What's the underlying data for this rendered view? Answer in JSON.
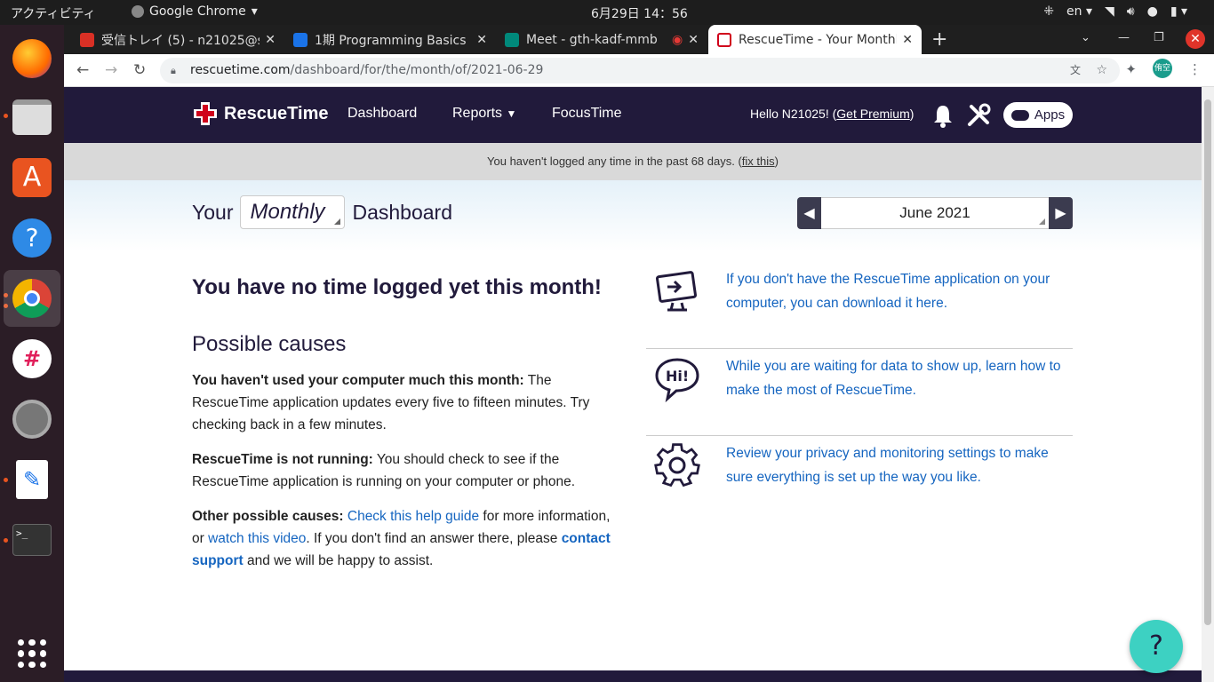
{
  "system": {
    "activities": "アクティビティ",
    "app_menu": "Google Chrome",
    "clock": "6月29日 14：56",
    "keyboard_layout": "en"
  },
  "dock": {
    "items": [
      "firefox",
      "files",
      "ubuntu-software",
      "help",
      "chrome",
      "slack",
      "settings",
      "text-editor",
      "terminal",
      "show-applications"
    ]
  },
  "browser": {
    "tabs": [
      {
        "label": "受信トレイ (5) - n21025@s",
        "favicon_color": "#d93025"
      },
      {
        "label": "1期 Programming Basics",
        "favicon_color": "#1a73e8"
      },
      {
        "label": "Meet - gth-kadf-mmb",
        "favicon_color": "#00897b"
      },
      {
        "label": "RescueTime - Your Monthl",
        "favicon_color": "#d0021b",
        "active": true
      }
    ],
    "url_domain": "rescuetime.com",
    "url_path": "/dashboard/for/the/month/of/2021-06-29",
    "profile_initials": "侑空"
  },
  "header": {
    "logo_text": "RescueTime",
    "nav": [
      "Dashboard",
      "Reports",
      "FocusTime"
    ],
    "greeting": "Hello N21025! (",
    "get_premium": "Get Premium",
    "greeting_end": ")",
    "apps_label": "Apps"
  },
  "warning": {
    "text": "You haven't logged any time in the past 68 days. (",
    "fix_link": "fix this",
    "text_end": ")"
  },
  "dashboard": {
    "title_prefix": "Your",
    "period": "Monthly",
    "title_suffix": "Dashboard",
    "month": "June 2021"
  },
  "main": {
    "heading": "You have no time logged yet this month!",
    "causes_heading": "Possible causes",
    "cause1_bold": "You haven't used your computer much this month:",
    "cause1_text": " The RescueTime application updates every five to fifteen minutes. Try checking back in a few minutes.",
    "cause2_bold": "RescueTime is not running:",
    "cause2_text": " You should check to see if the RescueTime application is running on your computer or phone.",
    "cause3_bold": "Other possible causes:",
    "cause3_link1": "Check this help guide",
    "cause3_text1": " for more information, or ",
    "cause3_link2": "watch this video",
    "cause3_text2": ". If you don't find an answer there, please ",
    "cause3_link3": "contact support",
    "cause3_text3": " and we will be happy to assist."
  },
  "sidebar": {
    "items": [
      {
        "icon": "download-computer-icon",
        "text": "If you don't have the RescueTime application on your computer, you can download it here."
      },
      {
        "icon": "hi-speech-bubble-icon",
        "text": "While you are waiting for data to show up, learn how to make the most of RescueTime."
      },
      {
        "icon": "gear-icon",
        "text": "Review your privacy and monitoring settings to make sure everything is set up the way you like."
      }
    ]
  },
  "help_button": "?",
  "colors": {
    "brand_dark": "#211a3b",
    "link": "#1565c0",
    "help_fab": "#3dd1c2"
  }
}
